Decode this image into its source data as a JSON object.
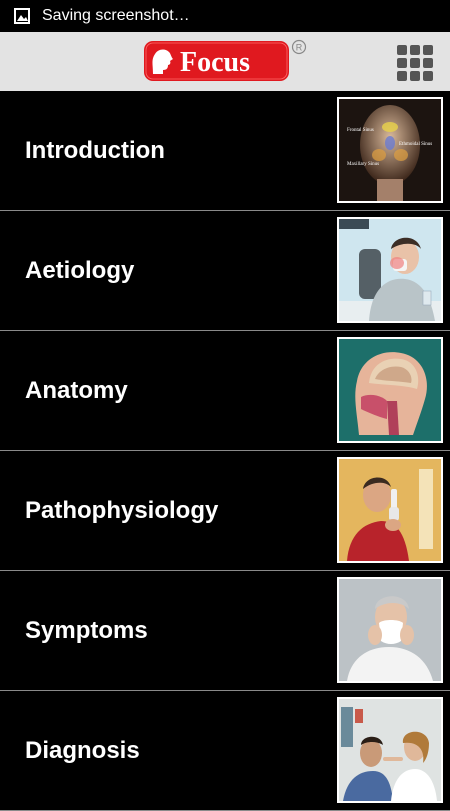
{
  "status_bar": {
    "notification_text": "Saving screenshot…",
    "icon": "image-icon"
  },
  "app_bar": {
    "logo_text": "Focus",
    "logo_mark": "®",
    "menu_icon": "grid-menu-icon",
    "brand_color": "#e0191f"
  },
  "topics": [
    {
      "label": "Introduction",
      "thumbnail": "sinus-face-illustration",
      "thumb_captions": [
        "Frontal Sinus",
        "Ethmoidal Sinus",
        "Maxillary Sinus"
      ]
    },
    {
      "label": "Aetiology",
      "thumbnail": "man-sneezing-illustration"
    },
    {
      "label": "Anatomy",
      "thumbnail": "head-cross-section-illustration"
    },
    {
      "label": "Pathophysiology",
      "thumbnail": "man-using-nasal-spray-illustration"
    },
    {
      "label": "Symptoms",
      "thumbnail": "man-with-tissue-illustration"
    },
    {
      "label": "Diagnosis",
      "thumbnail": "doctor-examining-patient-illustration"
    }
  ]
}
